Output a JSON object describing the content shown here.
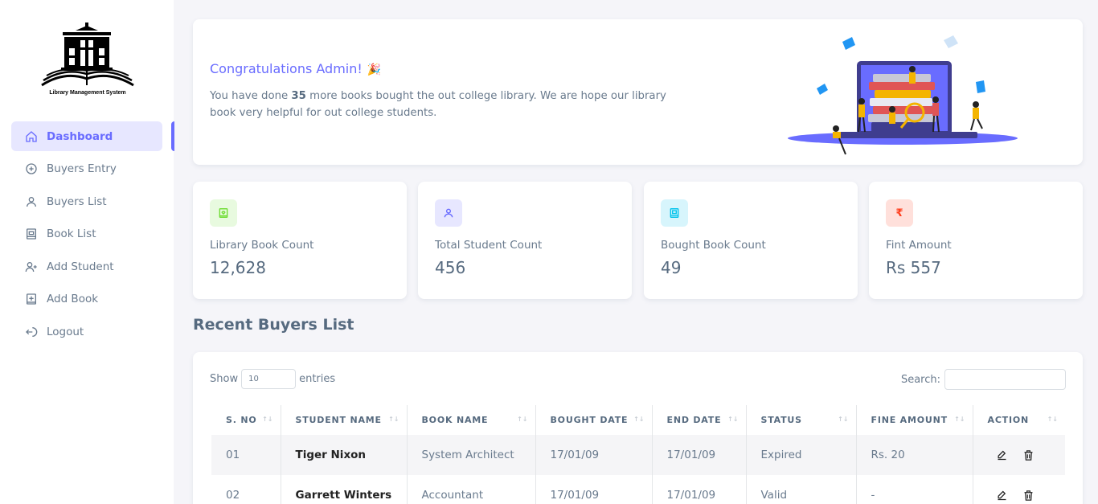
{
  "brand": {
    "logo_text": "Library Management System"
  },
  "sidebar": {
    "items": [
      {
        "label": "Dashboard",
        "icon": "home-icon",
        "active": true
      },
      {
        "label": "Buyers Entry",
        "icon": "plus-circle-icon"
      },
      {
        "label": "Buyers List",
        "icon": "user-icon"
      },
      {
        "label": "Book List",
        "icon": "book-icon"
      },
      {
        "label": "Add Student",
        "icon": "user-plus-icon"
      },
      {
        "label": "Add Book",
        "icon": "add-box-icon"
      },
      {
        "label": "Logout",
        "icon": "logout-icon"
      }
    ]
  },
  "welcome": {
    "title": "Congratulations Admin!",
    "text_before": "You have done ",
    "count": "35",
    "text_after": " more books bought the out college library. We are hope our library book very helpful for out college students."
  },
  "stats": [
    {
      "label": "Library Book Count",
      "value": "12,628",
      "icon": "book-heart-icon",
      "color": "#71dd37",
      "bg": "#e8fadf"
    },
    {
      "label": "Total Student Count",
      "value": "456",
      "icon": "user-icon",
      "color": "#696cff",
      "bg": "#e7e7ff"
    },
    {
      "label": "Bought Book Count",
      "value": "49",
      "icon": "book-icon",
      "color": "#03c3ec",
      "bg": "#d7f5fc"
    },
    {
      "label": "Fint Amount",
      "value": "Rs 557",
      "icon": "rupee-icon",
      "color": "#ff3e1d",
      "bg": "#ffe0db"
    }
  ],
  "recent": {
    "title": "Recent Buyers List",
    "show_label": "Show",
    "entries_value": "10",
    "entries_label": "entries",
    "search_label": "Search:",
    "columns": [
      "S. NO",
      "STUDENT NAME",
      "BOOK NAME",
      "BOUGHT DATE",
      "END DATE",
      "STATUS",
      "FINE AMOUNT",
      "ACTION"
    ],
    "rows": [
      {
        "sno": "01",
        "student": "Tiger Nixon",
        "book": "System Architect",
        "bought": "17/01/09",
        "end": "17/01/09",
        "status": "Expired",
        "fine": "Rs. 20"
      },
      {
        "sno": "02",
        "student": "Garrett Winters",
        "book": "Accountant",
        "bought": "17/01/09",
        "end": "17/01/09",
        "status": "Valid",
        "fine": "-"
      }
    ]
  },
  "colors": {
    "primary": "#696cff",
    "text": "#697a8d",
    "heading": "#566a7f",
    "background": "#f5f5f9"
  }
}
